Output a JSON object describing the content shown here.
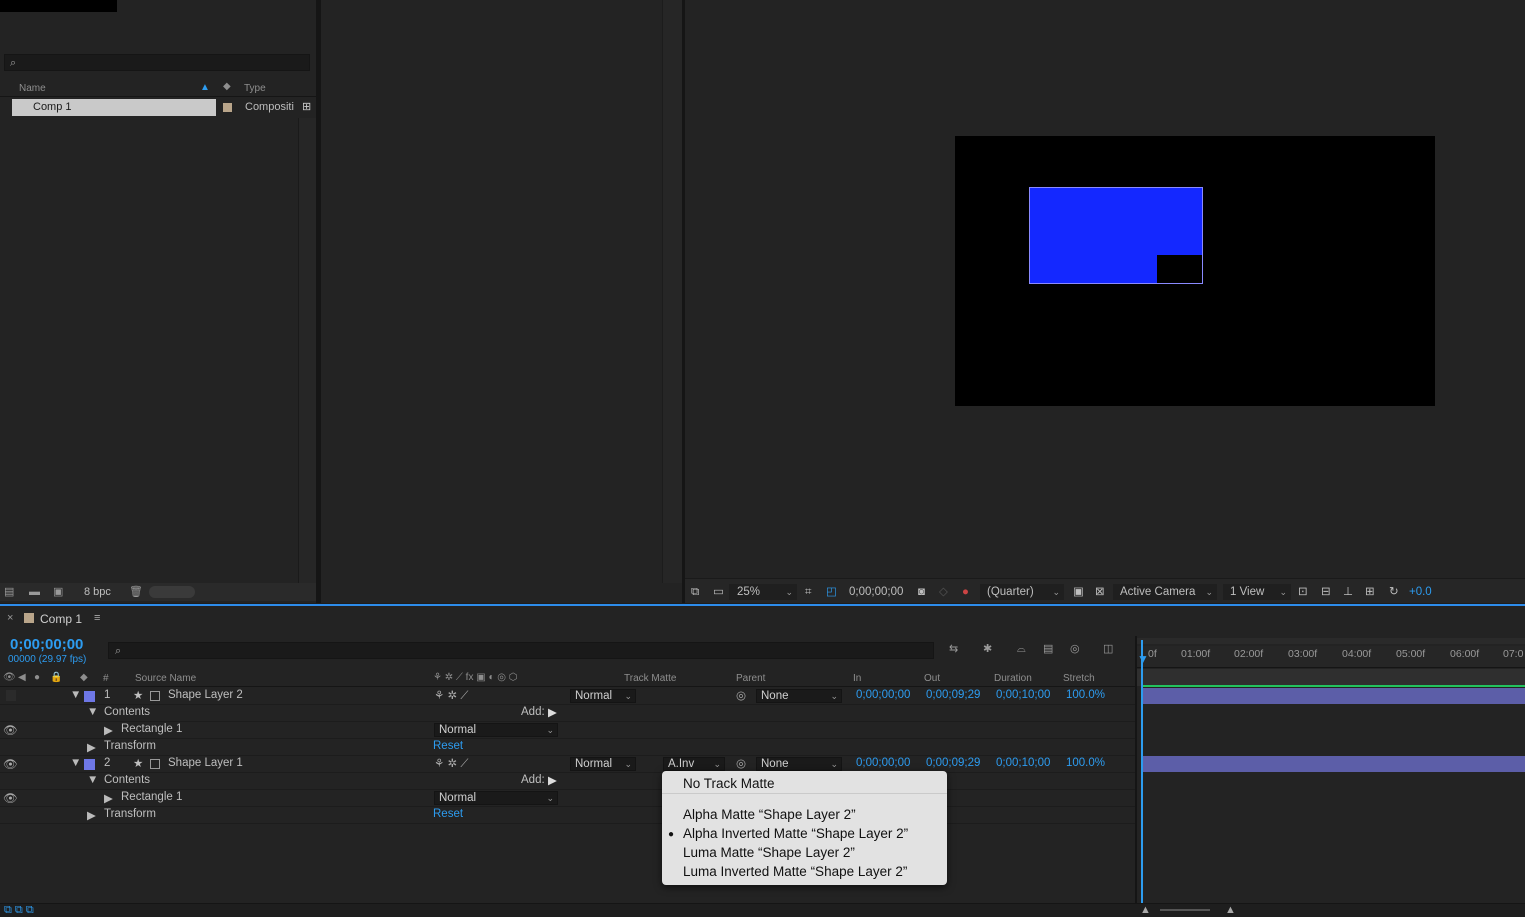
{
  "project": {
    "search_placeholder": "",
    "col_name": "Name",
    "col_type": "Type",
    "item_name": "Comp 1",
    "item_type": "Compositi",
    "bpc": "8 bpc"
  },
  "viewer": {
    "zoom": "25%",
    "timecode": "0;00;00;00",
    "resolution": "(Quarter)",
    "camera": "Active Camera",
    "views": "1 View",
    "exposure": "+0.0",
    "shape_color": "#1428ff"
  },
  "timeline": {
    "tab": "Comp 1",
    "timecode": "0;00;00;00",
    "frames": "00000 (29.97 fps)",
    "columns": {
      "num": "#",
      "source": "Source Name",
      "track_matte": "Track Matte",
      "parent": "Parent",
      "in": "In",
      "out": "Out",
      "duration": "Duration",
      "stretch": "Stretch"
    },
    "ruler": [
      "0f",
      "01:00f",
      "02:00f",
      "03:00f",
      "04:00f",
      "05:00f",
      "06:00f",
      "07:0"
    ],
    "layers": [
      {
        "num": "1",
        "name": "Shape Layer 2",
        "mode": "Normal",
        "matte": "",
        "parent": "None",
        "in": "0;00;00;00",
        "out": "0;00;09;29",
        "duration": "0;00;10;00",
        "stretch": "100.0%",
        "contents": "Contents",
        "add": "Add:",
        "rect": "Rectangle 1",
        "rect_mode": "Normal",
        "transform": "Transform",
        "reset": "Reset"
      },
      {
        "num": "2",
        "name": "Shape Layer 1",
        "mode": "Normal",
        "matte": "A.Inv",
        "parent": "None",
        "in": "0;00;00;00",
        "out": "0;00;09;29",
        "duration": "0;00;10;00",
        "stretch": "100.0%",
        "contents": "Contents",
        "add": "Add:",
        "rect": "Rectangle 1",
        "rect_mode": "Normal",
        "transform": "Transform",
        "reset": "Reset"
      }
    ]
  },
  "menu": {
    "items": [
      "No Track Matte",
      "Alpha Matte “Shape Layer 2”",
      "Alpha Inverted Matte “Shape Layer 2”",
      "Luma Matte “Shape Layer 2”",
      "Luma Inverted Matte “Shape Layer 2”"
    ],
    "selected_index": 2
  }
}
